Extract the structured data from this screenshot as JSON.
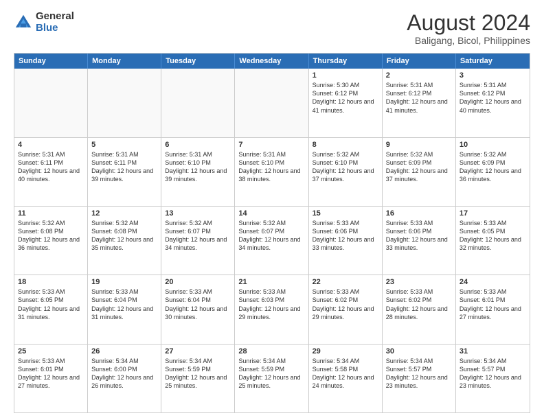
{
  "logo": {
    "general": "General",
    "blue": "Blue"
  },
  "title": "August 2024",
  "subtitle": "Baligang, Bicol, Philippines",
  "days": [
    "Sunday",
    "Monday",
    "Tuesday",
    "Wednesday",
    "Thursday",
    "Friday",
    "Saturday"
  ],
  "rows": [
    [
      {
        "day": "",
        "empty": true
      },
      {
        "day": "",
        "empty": true
      },
      {
        "day": "",
        "empty": true
      },
      {
        "day": "",
        "empty": true
      },
      {
        "day": "1",
        "sunrise": "5:30 AM",
        "sunset": "6:12 PM",
        "daylight": "12 hours and 41 minutes."
      },
      {
        "day": "2",
        "sunrise": "5:31 AM",
        "sunset": "6:12 PM",
        "daylight": "12 hours and 41 minutes."
      },
      {
        "day": "3",
        "sunrise": "5:31 AM",
        "sunset": "6:12 PM",
        "daylight": "12 hours and 40 minutes."
      }
    ],
    [
      {
        "day": "4",
        "sunrise": "5:31 AM",
        "sunset": "6:11 PM",
        "daylight": "12 hours and 40 minutes."
      },
      {
        "day": "5",
        "sunrise": "5:31 AM",
        "sunset": "6:11 PM",
        "daylight": "12 hours and 39 minutes."
      },
      {
        "day": "6",
        "sunrise": "5:31 AM",
        "sunset": "6:10 PM",
        "daylight": "12 hours and 39 minutes."
      },
      {
        "day": "7",
        "sunrise": "5:31 AM",
        "sunset": "6:10 PM",
        "daylight": "12 hours and 38 minutes."
      },
      {
        "day": "8",
        "sunrise": "5:32 AM",
        "sunset": "6:10 PM",
        "daylight": "12 hours and 37 minutes."
      },
      {
        "day": "9",
        "sunrise": "5:32 AM",
        "sunset": "6:09 PM",
        "daylight": "12 hours and 37 minutes."
      },
      {
        "day": "10",
        "sunrise": "5:32 AM",
        "sunset": "6:09 PM",
        "daylight": "12 hours and 36 minutes."
      }
    ],
    [
      {
        "day": "11",
        "sunrise": "5:32 AM",
        "sunset": "6:08 PM",
        "daylight": "12 hours and 36 minutes."
      },
      {
        "day": "12",
        "sunrise": "5:32 AM",
        "sunset": "6:08 PM",
        "daylight": "12 hours and 35 minutes."
      },
      {
        "day": "13",
        "sunrise": "5:32 AM",
        "sunset": "6:07 PM",
        "daylight": "12 hours and 34 minutes."
      },
      {
        "day": "14",
        "sunrise": "5:32 AM",
        "sunset": "6:07 PM",
        "daylight": "12 hours and 34 minutes."
      },
      {
        "day": "15",
        "sunrise": "5:33 AM",
        "sunset": "6:06 PM",
        "daylight": "12 hours and 33 minutes."
      },
      {
        "day": "16",
        "sunrise": "5:33 AM",
        "sunset": "6:06 PM",
        "daylight": "12 hours and 33 minutes."
      },
      {
        "day": "17",
        "sunrise": "5:33 AM",
        "sunset": "6:05 PM",
        "daylight": "12 hours and 32 minutes."
      }
    ],
    [
      {
        "day": "18",
        "sunrise": "5:33 AM",
        "sunset": "6:05 PM",
        "daylight": "12 hours and 31 minutes."
      },
      {
        "day": "19",
        "sunrise": "5:33 AM",
        "sunset": "6:04 PM",
        "daylight": "12 hours and 31 minutes."
      },
      {
        "day": "20",
        "sunrise": "5:33 AM",
        "sunset": "6:04 PM",
        "daylight": "12 hours and 30 minutes."
      },
      {
        "day": "21",
        "sunrise": "5:33 AM",
        "sunset": "6:03 PM",
        "daylight": "12 hours and 29 minutes."
      },
      {
        "day": "22",
        "sunrise": "5:33 AM",
        "sunset": "6:02 PM",
        "daylight": "12 hours and 29 minutes."
      },
      {
        "day": "23",
        "sunrise": "5:33 AM",
        "sunset": "6:02 PM",
        "daylight": "12 hours and 28 minutes."
      },
      {
        "day": "24",
        "sunrise": "5:33 AM",
        "sunset": "6:01 PM",
        "daylight": "12 hours and 27 minutes."
      }
    ],
    [
      {
        "day": "25",
        "sunrise": "5:33 AM",
        "sunset": "6:01 PM",
        "daylight": "12 hours and 27 minutes."
      },
      {
        "day": "26",
        "sunrise": "5:34 AM",
        "sunset": "6:00 PM",
        "daylight": "12 hours and 26 minutes."
      },
      {
        "day": "27",
        "sunrise": "5:34 AM",
        "sunset": "5:59 PM",
        "daylight": "12 hours and 25 minutes."
      },
      {
        "day": "28",
        "sunrise": "5:34 AM",
        "sunset": "5:59 PM",
        "daylight": "12 hours and 25 minutes."
      },
      {
        "day": "29",
        "sunrise": "5:34 AM",
        "sunset": "5:58 PM",
        "daylight": "12 hours and 24 minutes."
      },
      {
        "day": "30",
        "sunrise": "5:34 AM",
        "sunset": "5:57 PM",
        "daylight": "12 hours and 23 minutes."
      },
      {
        "day": "31",
        "sunrise": "5:34 AM",
        "sunset": "5:57 PM",
        "daylight": "12 hours and 23 minutes."
      }
    ]
  ]
}
